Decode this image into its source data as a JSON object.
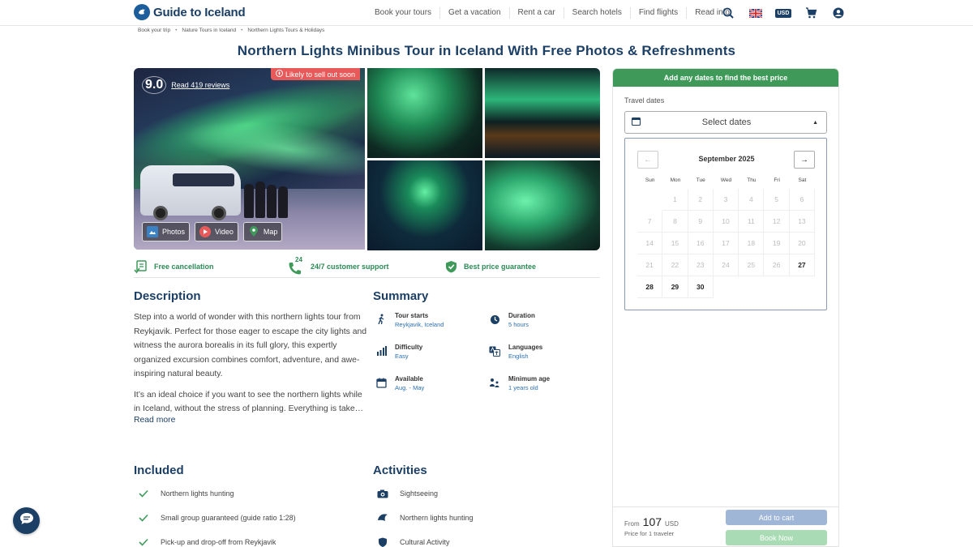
{
  "header": {
    "logo_text": "Guide to Iceland",
    "nav": [
      "Book your tours",
      "Get a vacation",
      "Rent a car",
      "Search hotels",
      "Find flights",
      "Read info"
    ],
    "currency": "USD"
  },
  "breadcrumb": [
    "Book your trip",
    "Nature Tours in Iceland",
    "Northern Lights Tours & Holidays"
  ],
  "title": "Northern Lights Minibus Tour in Iceland With Free Photos & Refreshments",
  "gallery": {
    "rating": "9.0",
    "reviews_link": "Read 419 reviews",
    "sell_badge": "Likely to sell out soon",
    "buttons": [
      "Photos",
      "Video",
      "Map"
    ]
  },
  "features": [
    "Free cancellation",
    "24/7 customer support",
    "Best price guarantee"
  ],
  "features_support_badge": "24",
  "description": {
    "heading": "Description",
    "p1": "Step into a world of wonder with this northern lights tour from Reykjavik. Perfect for those eager to escape the city lights and witness the aurora borealis in its full glory, this expertly organized excursion combines comfort, adventure, and awe-inspiring natural beauty.",
    "p2": "It’s an ideal choice if you want to see the northern lights while in Iceland, without the stress of planning. Everything is take…",
    "read_more": "Read more"
  },
  "summary": {
    "heading": "Summary",
    "items": [
      {
        "label": "Tour starts",
        "value": "Reykjavik, Iceland",
        "icon": "walker-icon"
      },
      {
        "label": "Duration",
        "value": "5 hours",
        "icon": "clock-icon"
      },
      {
        "label": "Difficulty",
        "value": "Easy",
        "icon": "bars-icon"
      },
      {
        "label": "Languages",
        "value": "English",
        "icon": "language-icon"
      },
      {
        "label": "Available",
        "value": "Aug. - May",
        "icon": "calendar-icon"
      },
      {
        "label": "Minimum age",
        "value": "1 years old",
        "icon": "age-icon"
      }
    ]
  },
  "included": {
    "heading": "Included",
    "items": [
      "Northern lights hunting",
      "Small group guaranteed (guide ratio 1:28)",
      "Pick-up and drop-off from Reykjavik"
    ]
  },
  "activities": {
    "heading": "Activities",
    "items": [
      "Sightseeing",
      "Northern lights hunting",
      "Cultural Activity"
    ]
  },
  "booking": {
    "header": "Add any dates to find the best price",
    "travel_label": "Travel dates",
    "select_placeholder": "Select dates",
    "calendar": {
      "month": "September 2025",
      "weekdays": [
        "Sun",
        "Mon",
        "Tue",
        "Wed",
        "Thu",
        "Fri",
        "Sat"
      ],
      "leading_blanks": 1,
      "days_in_month": 30,
      "available_days": [
        27,
        28,
        29,
        30
      ]
    },
    "from_label": "From",
    "price": "107",
    "currency": "USD",
    "price_sub": "Price for 1 traveler",
    "add_to_cart": "Add to cart",
    "book_now": "Book Now"
  },
  "colors": {
    "brand_navy": "#1c3f66",
    "green": "#3f9a5a",
    "badge_red": "#e85a5a"
  }
}
